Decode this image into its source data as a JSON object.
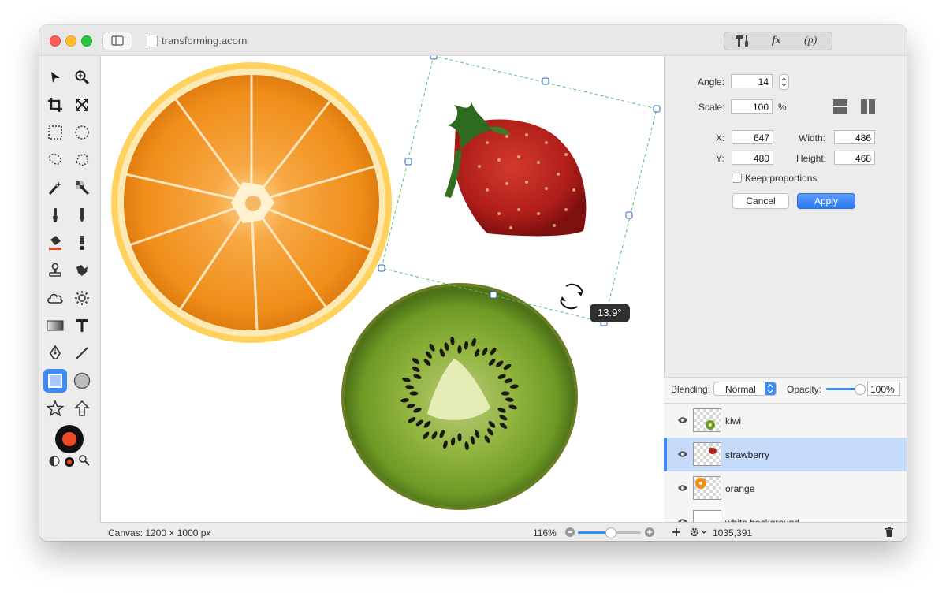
{
  "window": {
    "title": "transforming.acorn"
  },
  "toolbar": {
    "tools_icon": "hammer-screwdriver-icon",
    "fx_label": "fx",
    "p_label": "(p)"
  },
  "transform": {
    "angle_label": "Angle:",
    "angle_value": "14",
    "scale_label": "Scale:",
    "scale_value": "100",
    "scale_unit": "%",
    "x_label": "X:",
    "x_value": "647",
    "y_label": "Y:",
    "y_value": "480",
    "width_label": "Width:",
    "width_value": "486",
    "height_label": "Height:",
    "height_value": "468",
    "keep_proportions": "Keep proportions",
    "cancel": "Cancel",
    "apply": "Apply"
  },
  "canvas": {
    "rotation_tooltip": "13.9°"
  },
  "status": {
    "canvas_size": "Canvas: 1200 × 1000 px",
    "zoom": "116%"
  },
  "layers_panel": {
    "blending_label": "Blending:",
    "blending_value": "Normal",
    "opacity_label": "Opacity:",
    "opacity_value": "100%",
    "items": [
      {
        "name": "kiwi",
        "selected": false
      },
      {
        "name": "strawberry",
        "selected": true
      },
      {
        "name": "orange",
        "selected": false
      },
      {
        "name": "white background",
        "selected": false
      }
    ],
    "coords": "1035,391"
  },
  "colors": {
    "accent": "#3d8bf7",
    "selection_row": "#c6dafa",
    "fg_color": "#ea4a24"
  }
}
